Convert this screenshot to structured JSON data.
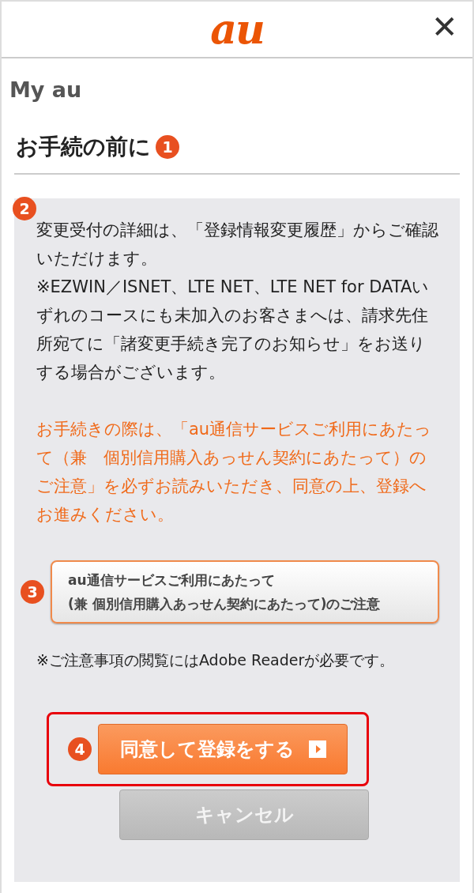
{
  "header": {
    "logo": "au",
    "close": "✕"
  },
  "breadcrumb": "My au",
  "heading": {
    "text": "お手続の前に",
    "callout": "1"
  },
  "panel": {
    "callout": "2",
    "paragraphs": [
      {
        "kind": "normal",
        "text": "変更受付の詳細は、「登録情報変更履歴」からご確認いただけます。"
      },
      {
        "kind": "normal",
        "text": "※EZWIN／ISNET、LTE NET、LTE NET for DATAいずれのコースにも未加入のお客さまへは、請求先住所宛てに「諸変更手続き完了のお知らせ」をお送りする場合がございます。"
      },
      {
        "kind": "notice",
        "text": "お手続きの際は、「au通信サービスご利用にあたって（兼　個別信用購入あっせん契約にあたって）のご注意」を必ずお読みいただき、同意の上、登録へお進みください。"
      }
    ],
    "doc_button": {
      "callout": "3",
      "lines": [
        "au通信サービスご利用にあたって",
        "(兼 個別信用購入あっせん契約にあたって)のご注意"
      ]
    },
    "note": "※ご注意事項の閲覧にはAdobe Readerが必要です。",
    "agree_button": {
      "callout": "4",
      "label": "同意して登録をする",
      "highlighted": true
    },
    "cancel_button": {
      "label": "キャンセル",
      "disabled": true
    }
  }
}
